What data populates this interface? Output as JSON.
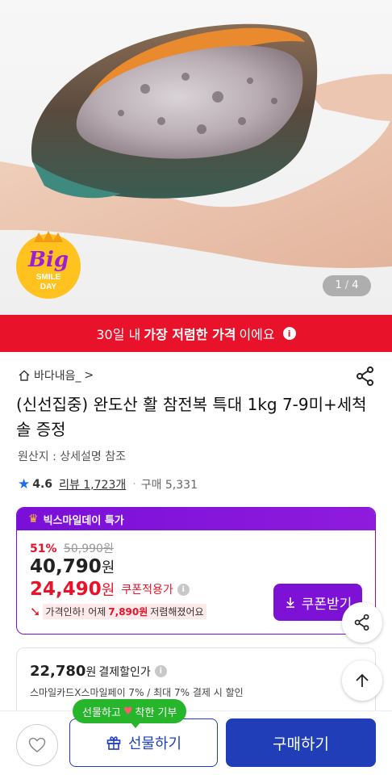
{
  "gallery": {
    "current": "1",
    "separator": "/",
    "total": "4",
    "badge": {
      "line1": "Big",
      "line2": "SMILE",
      "line3": "DAY"
    }
  },
  "banner": {
    "prefix": "30일 내",
    "emphasis": "가장 저렴한 가격",
    "suffix": "이에요",
    "info": "i"
  },
  "store": {
    "name": "바다내음_",
    "chevron": ">"
  },
  "product": {
    "title": "(신선집중) 완도산 활 참전복 특대 1kg 7-9미+세척 솔 증정",
    "origin": "원산지 : 상세설명 참조"
  },
  "rating": {
    "star": "★",
    "score": "4.6",
    "reviews": "리뷰 1,723개",
    "dot": "·",
    "purchases": "구매 5,331"
  },
  "deal": {
    "header": "빅스마일데이 특가",
    "discount_pct": "51%",
    "original_price": "50,990원",
    "price": "40,790",
    "price_unit": "원",
    "coupon_price": "24,490",
    "coupon_unit": "원",
    "coupon_label": "쿠폰적용가",
    "drop_prefix": "가격인하! 어제",
    "drop_amount": "7,890원",
    "drop_suffix": "저렴해졌어요",
    "coupon_button": "쿠폰받기",
    "info": "i"
  },
  "payment": {
    "price": "22,780",
    "unit": "원",
    "label": "결제할인가",
    "info": "i",
    "sub": "스마일카드X스마일페이 7% / 최대 7% 결제 시 할인"
  },
  "bottom": {
    "tooltip_before": "선물하고",
    "tooltip_heart": "♥",
    "tooltip_after": "착한 기부",
    "gift_label": "선물하기",
    "buy_label": "구매하기"
  },
  "colors": {
    "banner_red": "#e8132a",
    "deal_purple": "#7d12d6",
    "buy_blue": "#1f3eb8",
    "tooltip_green": "#27b52b",
    "rating_star": "#1a6cf2"
  },
  "icons": [
    "home-icon",
    "share-icon",
    "info-icon",
    "crown-icon",
    "download-icon",
    "arrow-up-icon",
    "heart-icon",
    "gift-icon",
    "price-down-arrow-icon"
  ]
}
